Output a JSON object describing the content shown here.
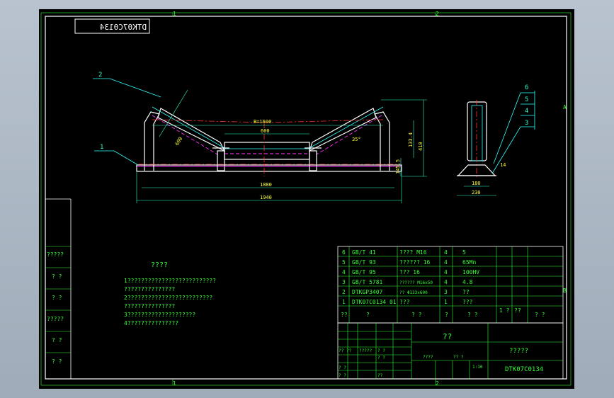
{
  "drawing_code_mirrored": "DTK07C0134",
  "grid_markers": {
    "top": [
      "1",
      "2"
    ],
    "bottom": [
      "1",
      "2"
    ],
    "right": [
      "A",
      "B"
    ]
  },
  "main_view": {
    "belt_width_label": "B=1600",
    "dims": {
      "center_width": "600",
      "inner_span": "1880",
      "overall_length": "1940",
      "height_total": "410",
      "height_roll": "133.4",
      "height_base": "145.5",
      "roll_len": "600",
      "angle": "35°"
    },
    "balloons": [
      "2",
      "1"
    ]
  },
  "side_view": {
    "dims": {
      "inner": "180",
      "outer": "230",
      "foot": "14"
    },
    "balloons": [
      "6",
      "5",
      "4",
      "3"
    ]
  },
  "notes": {
    "title": "????",
    "lines": [
      "1??????????????????????????",
      "???????????????",
      "2?????????????????????????",
      "???????????????",
      "3????????????????????",
      "4???????????????"
    ]
  },
  "left_margin_labels": [
    "?????",
    "? ?",
    "? ?",
    "?????",
    "? ?",
    "? ?"
  ],
  "bom": {
    "rows": [
      {
        "no": "6",
        "std": "GB/T 41",
        "name": "???? M16",
        "qty": "4",
        "mat": "5"
      },
      {
        "no": "5",
        "std": "GB/T 93",
        "name": "?????? 16",
        "qty": "4",
        "mat": "65Mn"
      },
      {
        "no": "4",
        "std": "GB/T 95",
        "name": "??? 16",
        "qty": "4",
        "mat": "100HV"
      },
      {
        "no": "3",
        "std": "GB/T 5781",
        "name": "?????? M16x50",
        "qty": "4",
        "mat": "4.8"
      },
      {
        "no": "2",
        "std": "DTKGP3407",
        "name": "?? Φ133x600",
        "qty": "3",
        "mat": "??"
      },
      {
        "no": "1",
        "std": "DTK07C0134 01",
        "name": "???",
        "qty": "1",
        "mat": "???"
      }
    ],
    "header": [
      "??",
      "?",
      "? ?",
      "?",
      "? ?",
      "1 ?",
      "??",
      "? ?"
    ]
  },
  "title_block": {
    "part_name": "??",
    "company": "?????",
    "drawing_no": "DTK07C0134",
    "scale": "1:10",
    "labels": [
      "?? ??",
      "?????",
      "? ?",
      "? ?",
      "? ?",
      "? ?",
      "????",
      "?? ?",
      "??"
    ]
  }
}
